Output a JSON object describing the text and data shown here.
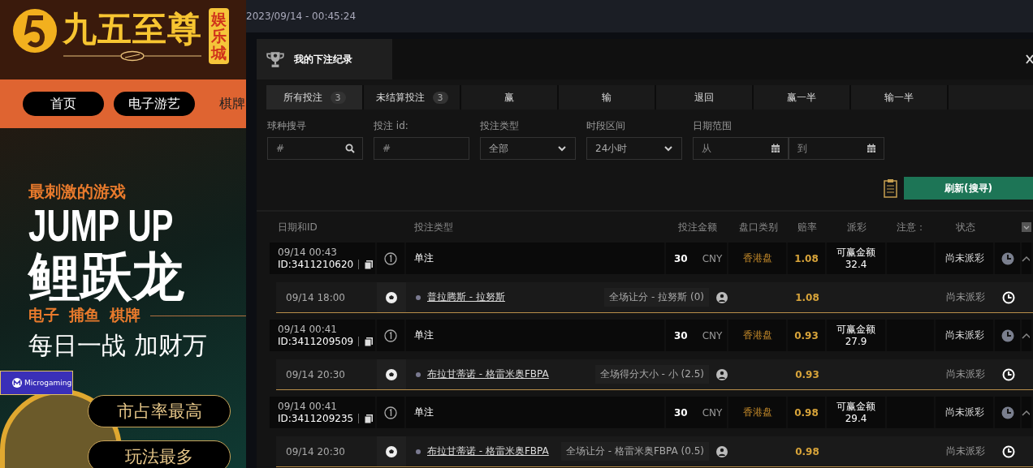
{
  "site": {
    "logo_text": "九五至尊",
    "logo_badge": "娱乐城",
    "nav": [
      {
        "label": "首页",
        "kind": "pill"
      },
      {
        "label": "电子游艺",
        "kind": "pill"
      },
      {
        "label": "棋牌",
        "kind": "plain"
      }
    ]
  },
  "banner": {
    "kicker": "最刺激的游戏",
    "headline": "JUMP UP",
    "title": "鲤跃龙",
    "tags": [
      "电子",
      "捕鱼",
      "棋牌"
    ],
    "slogan": "每日一战 加财万",
    "partner": "Microgaming",
    "pills": [
      "市占率最高",
      "玩法最多"
    ]
  },
  "timestamp": "2023/09/14 - 00:45:24",
  "modal": {
    "title": "我的下注纪录",
    "tabs": [
      {
        "label": "所有投注",
        "count": "3",
        "selected": true
      },
      {
        "label": "未结算投注",
        "count": "3",
        "selected": false
      },
      {
        "label": "赢",
        "selected": false
      },
      {
        "label": "输",
        "selected": false
      },
      {
        "label": "退回",
        "selected": false
      },
      {
        "label": "赢一半",
        "selected": false
      },
      {
        "label": "输一半",
        "selected": false
      }
    ],
    "filters": [
      {
        "kind": "search",
        "label": "球种搜寻",
        "placeholder": "#"
      },
      {
        "kind": "text",
        "label": "投注 id:",
        "placeholder": "#"
      },
      {
        "kind": "select",
        "label": "投注类型",
        "value": "全部"
      },
      {
        "kind": "select",
        "label": "时段区间",
        "value": "24小时"
      },
      {
        "kind": "daterange",
        "label": "日期范围",
        "from_placeholder": "从",
        "to_placeholder": "到"
      }
    ],
    "refresh_button": "刷新(搜寻)",
    "columns": [
      "日期和ID",
      "投注类型",
      "投注金额",
      "盘口类别",
      "赔率",
      "派彩",
      "注意：",
      "状态"
    ],
    "bets": [
      {
        "time": "09/14 00:43",
        "id": "ID:3411210620",
        "type": "单注",
        "amount": "30",
        "currency": "CNY",
        "market": "香港盘",
        "odds": "1.08",
        "payout_label": "可赢金额",
        "payout": "32.4",
        "status": "尚未派彩",
        "legs": [
          {
            "time": "09/14 18:00",
            "match": "普拉腾斯 - 拉努斯",
            "selection": "全场让分 - 拉努斯 (0)",
            "odds": "1.08",
            "status": "尚未派彩"
          }
        ]
      },
      {
        "time": "09/14 00:41",
        "id": "ID:3411209509",
        "type": "单注",
        "amount": "30",
        "currency": "CNY",
        "market": "香港盘",
        "odds": "0.93",
        "payout_label": "可赢金额",
        "payout": "27.9",
        "status": "尚未派彩",
        "legs": [
          {
            "time": "09/14 20:30",
            "match": "布拉甘蒂诺 - 格雷米奥FBPA",
            "selection": "全场得分大小 - 小 (2.5)",
            "odds": "0.93",
            "status": "尚未派彩"
          }
        ]
      },
      {
        "time": "09/14 00:41",
        "id": "ID:3411209235",
        "type": "单注",
        "amount": "30",
        "currency": "CNY",
        "market": "香港盘",
        "odds": "0.98",
        "payout_label": "可赢金额",
        "payout": "29.4",
        "status": "尚未派彩",
        "legs": [
          {
            "time": "09/14 20:30",
            "match": "布拉甘蒂诺 - 格雷米奥FBPA",
            "selection": "全场让分 - 格雷米奥FBPA (0.5)",
            "odds": "0.98",
            "status": "尚未派彩"
          }
        ]
      }
    ]
  }
}
